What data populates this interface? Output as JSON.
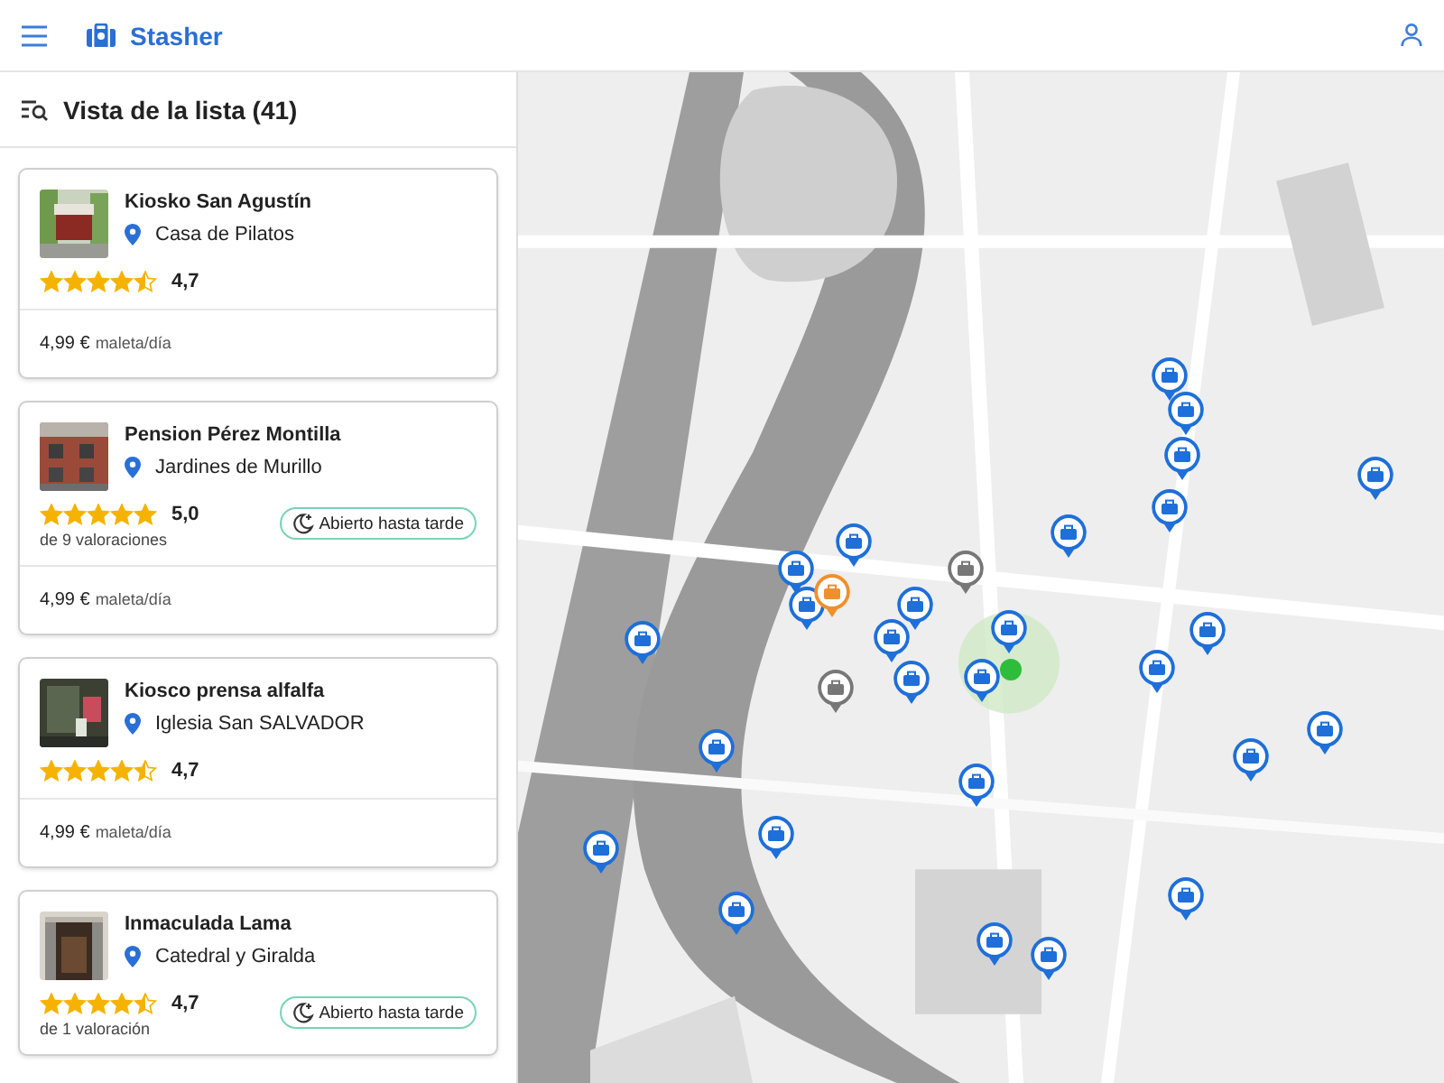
{
  "app": {
    "title": "Stasher"
  },
  "list_header": {
    "title": "Vista de la lista (41)"
  },
  "listings": [
    {
      "name": "Kiosko San Agustín",
      "location": "Casa de Pilatos",
      "stars": 4.5,
      "rating": "4,7",
      "price": "4,99 €",
      "unit": "maleta/día"
    },
    {
      "name": "Pension Pérez Montilla",
      "location": "Jardines de Murillo",
      "stars": 5,
      "rating": "5,0",
      "reviews": "de 9 valoraciones",
      "badge": "Abierto hasta tarde",
      "price": "4,99 €",
      "unit": "maleta/día"
    },
    {
      "name": "Kiosco prensa alfalfa",
      "location": "Iglesia San SALVADOR",
      "stars": 4.5,
      "rating": "4,7",
      "price": "4,99 €",
      "unit": "maleta/día"
    },
    {
      "name": "Inmaculada Lama",
      "location": "Catedral y Giralda",
      "stars": 4.5,
      "rating": "4,7",
      "reviews": "de 1 valoración",
      "badge": "Abierto hasta tarde"
    }
  ],
  "map_pins": [
    {
      "kind": "available"
    },
    {
      "kind": "available"
    },
    {
      "kind": "available"
    },
    {
      "kind": "available"
    },
    {
      "kind": "available"
    },
    {
      "kind": "available"
    },
    {
      "kind": "available"
    },
    {
      "kind": "available"
    },
    {
      "kind": "available"
    },
    {
      "kind": "available"
    },
    {
      "kind": "available"
    },
    {
      "kind": "available"
    },
    {
      "kind": "available"
    },
    {
      "kind": "available"
    },
    {
      "kind": "available"
    },
    {
      "kind": "available"
    },
    {
      "kind": "available"
    },
    {
      "kind": "available"
    },
    {
      "kind": "available"
    },
    {
      "kind": "available"
    },
    {
      "kind": "available"
    },
    {
      "kind": "available"
    },
    {
      "kind": "available"
    },
    {
      "kind": "available"
    },
    {
      "kind": "available"
    },
    {
      "kind": "available"
    },
    {
      "kind": "available"
    },
    {
      "kind": "closed"
    },
    {
      "kind": "closed"
    },
    {
      "kind": "selected"
    }
  ]
}
